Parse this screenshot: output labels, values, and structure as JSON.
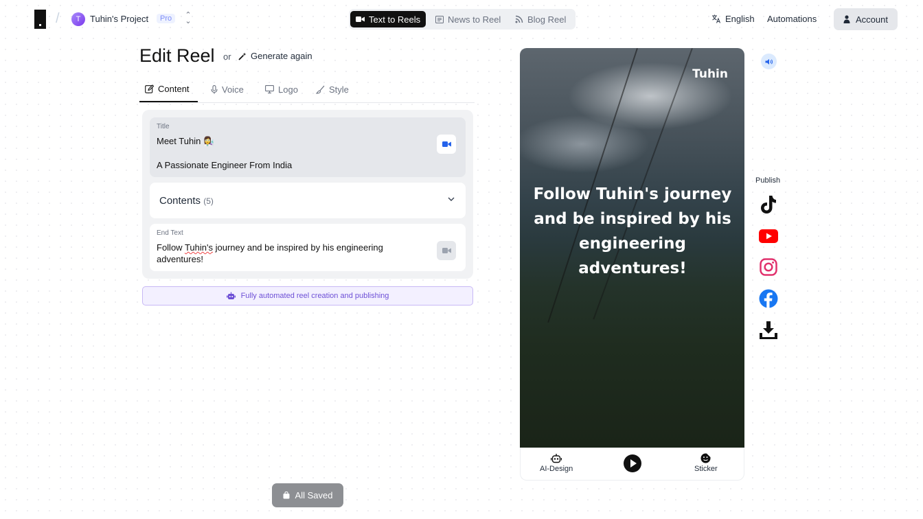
{
  "header": {
    "project_initial": "T",
    "project_name": "Tuhin's Project",
    "plan_badge": "Pro",
    "modes": [
      {
        "label": "Text to Reels",
        "active": true
      },
      {
        "label": "News to Reel",
        "active": false
      },
      {
        "label": "Blog Reel",
        "active": false
      }
    ],
    "language": "English",
    "automations": "Automations",
    "account": "Account"
  },
  "editor": {
    "heading": "Edit Reel",
    "or": "or",
    "generate_again": "Generate again",
    "tabs": [
      {
        "label": "Content",
        "icon": "pencil-icon",
        "active": true
      },
      {
        "label": "Voice",
        "icon": "microphone-icon",
        "active": false
      },
      {
        "label": "Logo",
        "icon": "monitor-icon",
        "active": false
      },
      {
        "label": "Style",
        "icon": "brush-icon",
        "active": false
      }
    ],
    "title_field": {
      "label": "Title",
      "title": "Meet Tuhin 👩‍🔬",
      "subtitle": "A Passionate Engineer From India"
    },
    "contents": {
      "label": "Contents",
      "count": "(5)"
    },
    "end_text": {
      "label": "End Text",
      "before": "Follow ",
      "misspelled": "Tuhin's",
      "after": " journey and be inspired by his engineering adventures!"
    },
    "automation_banner": "Fully automated reel creation and publishing",
    "saved_status": "All Saved"
  },
  "preview": {
    "watermark": "Tuhin",
    "caption": "Follow Tuhin's journey and be inspired by his engineering adventures!",
    "ai_design": "AI-Design",
    "sticker": "Sticker"
  },
  "publish": {
    "label": "Publish",
    "targets": [
      "tiktok-icon",
      "youtube-icon",
      "instagram-icon",
      "facebook-icon",
      "download-icon"
    ]
  },
  "colors": {
    "accent_purple": "#6d4fd6",
    "youtube": "#ff0000",
    "facebook": "#1877f2",
    "instagram": "#e1306c",
    "camera_blue": "#2563eb"
  }
}
